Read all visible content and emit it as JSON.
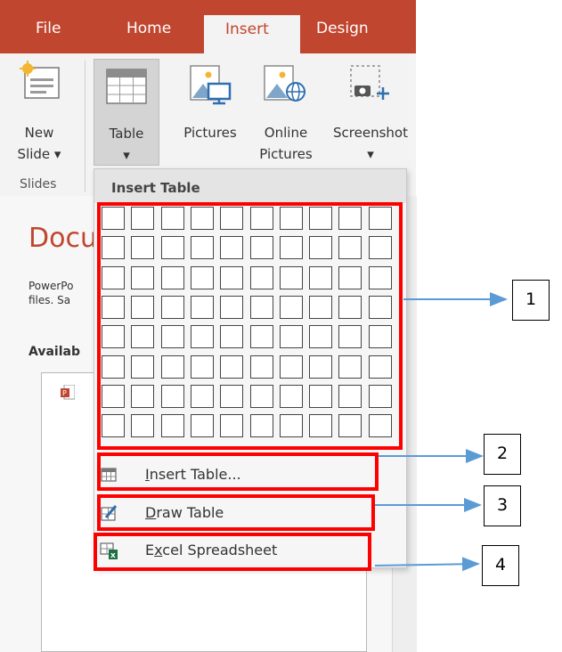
{
  "tabs": {
    "file": "File",
    "home": "Home",
    "insert": "Insert",
    "design": "Design"
  },
  "ribbon": {
    "new_slide": {
      "line1": "New",
      "line2": "Slide ▾"
    },
    "table": {
      "line1": "Table",
      "line2": "▾"
    },
    "pictures": "Pictures",
    "online_pictures": {
      "line1": "Online",
      "line2": "Pictures"
    },
    "screenshot": {
      "line1": "Screenshot",
      "line2": "▾"
    },
    "group_slides": "Slides"
  },
  "background": {
    "title": "Docu",
    "text_line1": "PowerPo",
    "text_line2": "files. Sa",
    "available": "Availab"
  },
  "dropdown": {
    "header": "Insert Table",
    "grid": {
      "rows": 8,
      "cols": 10
    },
    "items": {
      "insert_table": {
        "first": "I",
        "rest": "nsert Table...",
        "icon": "table-grid-icon"
      },
      "draw_table": {
        "first": "D",
        "rest": "raw Table",
        "icon": "pencil-table-icon"
      },
      "excel": {
        "pre": "E",
        "ul": "x",
        "rest": "cel Spreadsheet",
        "icon": "excel-icon"
      }
    }
  },
  "callouts": {
    "one": "1",
    "two": "2",
    "three": "3",
    "four": "4"
  },
  "colors": {
    "accent": "#c0462f",
    "highlight": "#ff0000",
    "arrow": "#5b9bd5"
  }
}
